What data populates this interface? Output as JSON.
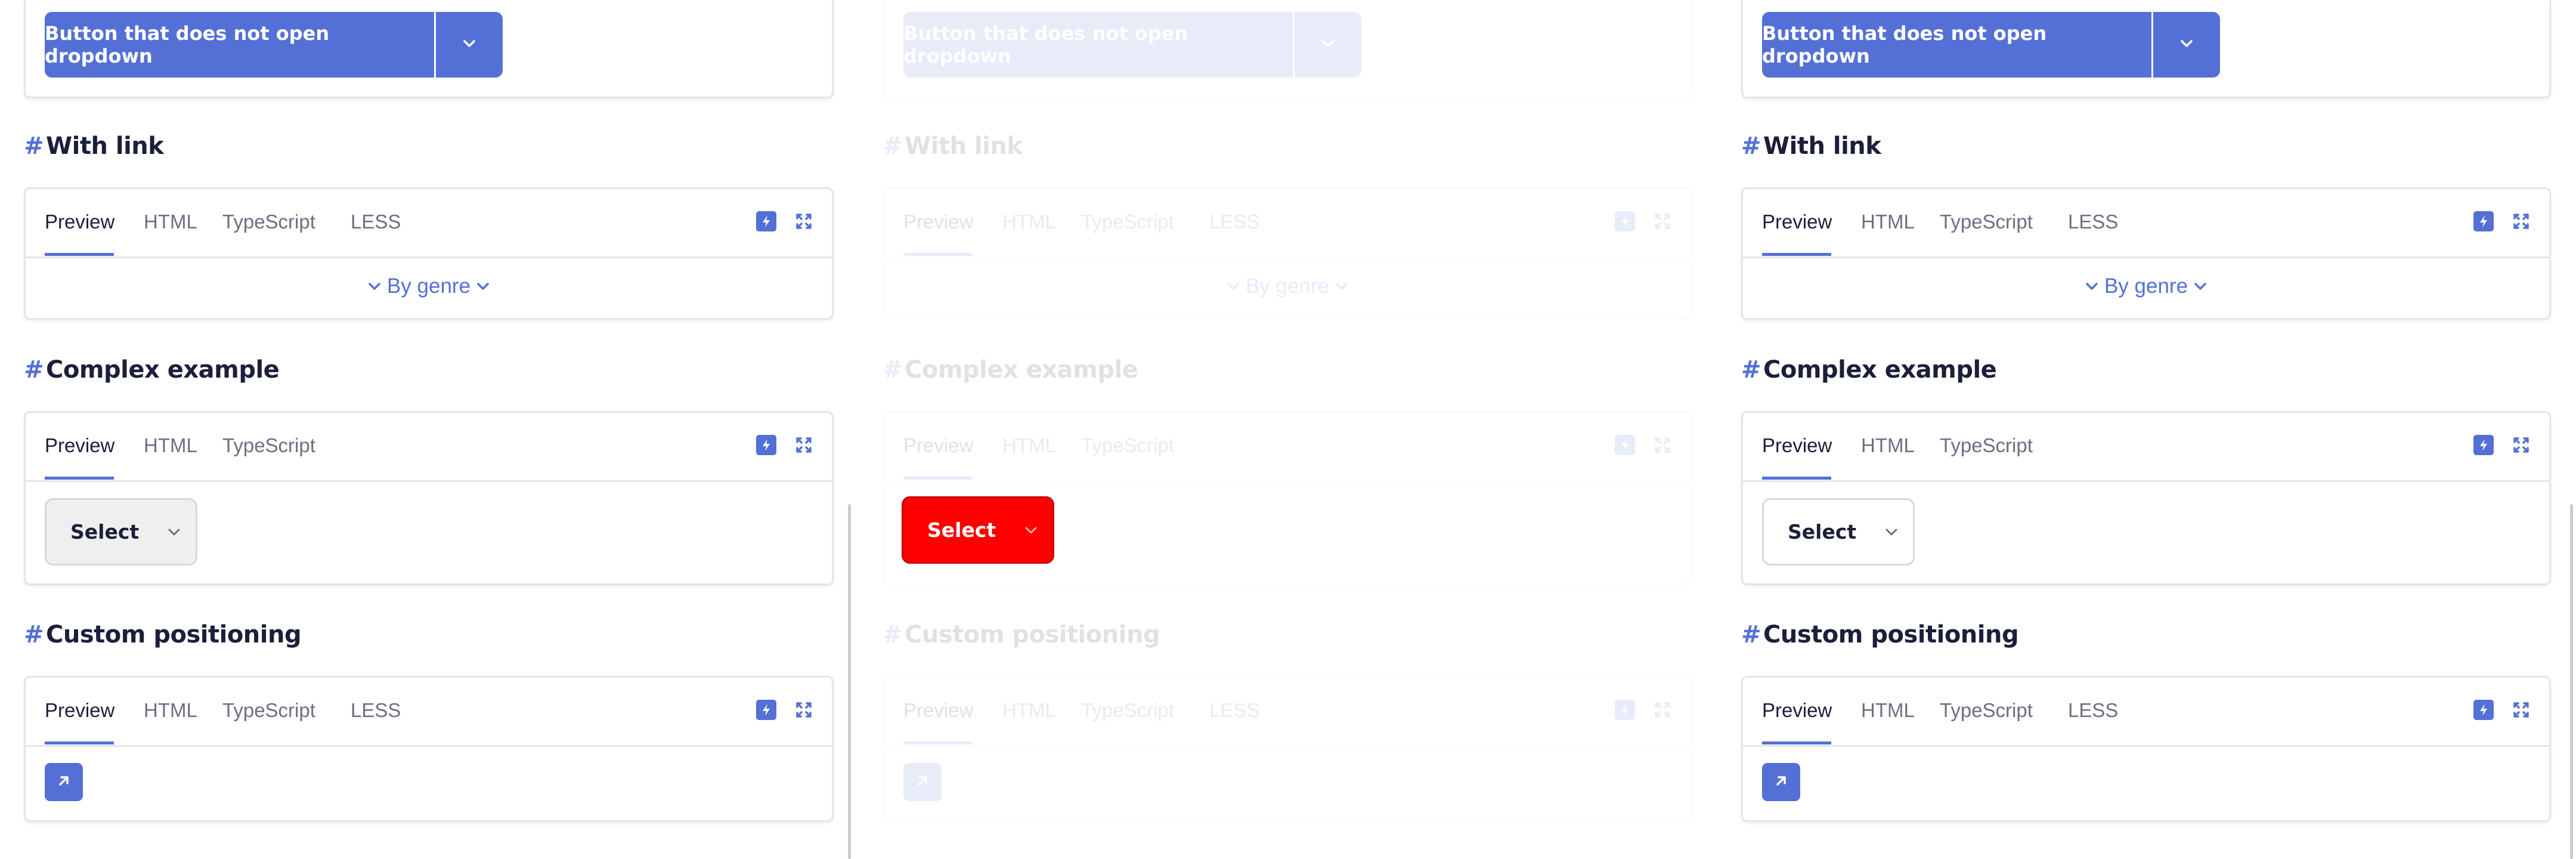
{
  "colors": {
    "accent": "#5470d6",
    "text": "#1b1f3b",
    "muted": "#6b6f80",
    "border": "#e3e5ea",
    "select_red": "#ff0000"
  },
  "split_button": {
    "label": "Button that does not open dropdown",
    "arrow_icon": "chevron-down-icon"
  },
  "sections": {
    "with_link": {
      "hash": "#",
      "title": "With link",
      "tabs": [
        "Preview",
        "HTML",
        "TypeScript",
        "LESS"
      ],
      "link_label": "By genre"
    },
    "complex": {
      "hash": "#",
      "title": "Complex example",
      "tabs": [
        "Preview",
        "HTML",
        "TypeScript"
      ],
      "select_label": "Select"
    },
    "positioning": {
      "hash": "#",
      "title": "Custom positioning",
      "tabs": [
        "Preview",
        "HTML",
        "TypeScript",
        "LESS"
      ],
      "button_icon": "arrow-up-right-icon"
    }
  },
  "toolbar_icons": [
    "stackblitz-icon",
    "fullscreen-icon"
  ],
  "panel_states": [
    "normal",
    "disabled-faded",
    "normal"
  ]
}
